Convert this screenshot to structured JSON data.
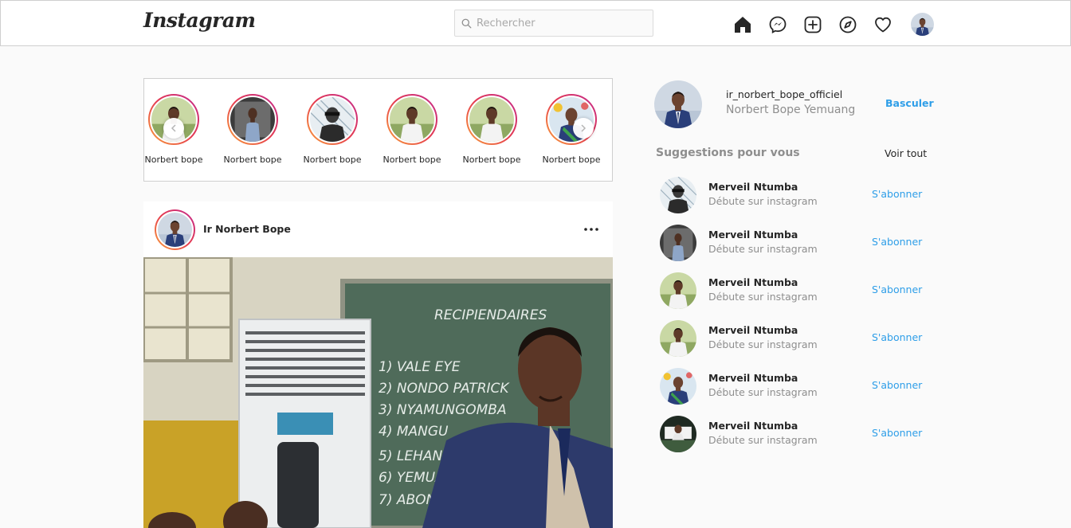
{
  "navbar": {
    "logo": "Instagram",
    "search_placeholder": "Rechercher",
    "icons": [
      "home-icon",
      "messenger-icon",
      "new-post-icon",
      "explore-icon",
      "heart-icon",
      "profile-avatar"
    ]
  },
  "stories": {
    "items": [
      {
        "name": "Norbert bope",
        "photo": "person-white-shirt-indoors"
      },
      {
        "name": "Norbert bope",
        "photo": "person-standing-dark"
      },
      {
        "name": "Norbert bope",
        "photo": "person-sketch-effect"
      },
      {
        "name": "Norbert bope",
        "photo": "person-outdoors-garden"
      },
      {
        "name": "Norbert bope",
        "photo": "person-white-shirt-outdoors"
      },
      {
        "name": "Norbert bope",
        "photo": "person-green-sash"
      }
    ],
    "prev_icon": "chevron-left-icon",
    "next_icon": "chevron-right-icon"
  },
  "post": {
    "author": "Ir Norbert Bope",
    "more_icon": "more-options-icon",
    "image": "man-in-suit-in-classroom-with-chalkboard",
    "chalkboard_text": [
      "RECIPIENDAIRES",
      "1) VALE EYE",
      "2) NONDO PATRICK",
      "3) NYAMUNGOMBA",
      "4) MANGU",
      "5) LEHANI",
      "6) YEMUANG",
      "7) ABONGO"
    ]
  },
  "sidebar": {
    "username": "ir_norbert_bope_officiel",
    "full_name": "Norbert Bope Yemuang",
    "switch_label": "Basculer",
    "suggestions_title": "Suggestions pour vous",
    "see_all_label": "Voir tout",
    "suggestions": [
      {
        "name": "Merveil Ntumba",
        "subtitle": "Débute sur instagram",
        "follow_label": "S'abonner",
        "photo": "person-sketch-effect"
      },
      {
        "name": "Merveil Ntumba",
        "subtitle": "Débute sur instagram",
        "follow_label": "S'abonner",
        "photo": "person-standing-dark"
      },
      {
        "name": "Merveil Ntumba",
        "subtitle": "Débute sur instagram",
        "follow_label": "S'abonner",
        "photo": "person-outdoors-garden"
      },
      {
        "name": "Merveil Ntumba",
        "subtitle": "Débute sur instagram",
        "follow_label": "S'abonner",
        "photo": "person-white-shirt-outdoors"
      },
      {
        "name": "Merveil Ntumba",
        "subtitle": "Débute sur instagram",
        "follow_label": "S'abonner",
        "photo": "person-green-sash"
      },
      {
        "name": "Merveil Ntumba",
        "subtitle": "Débute sur instagram",
        "follow_label": "S'abonner",
        "photo": "person-at-desk"
      }
    ]
  },
  "colors": {
    "accent": "#2e9ee8",
    "story_ring_start": "#f9a23a",
    "story_ring_mid": "#e53b4f",
    "story_ring_end": "#c22a8f",
    "secondary_text": "#8e8e8e"
  }
}
